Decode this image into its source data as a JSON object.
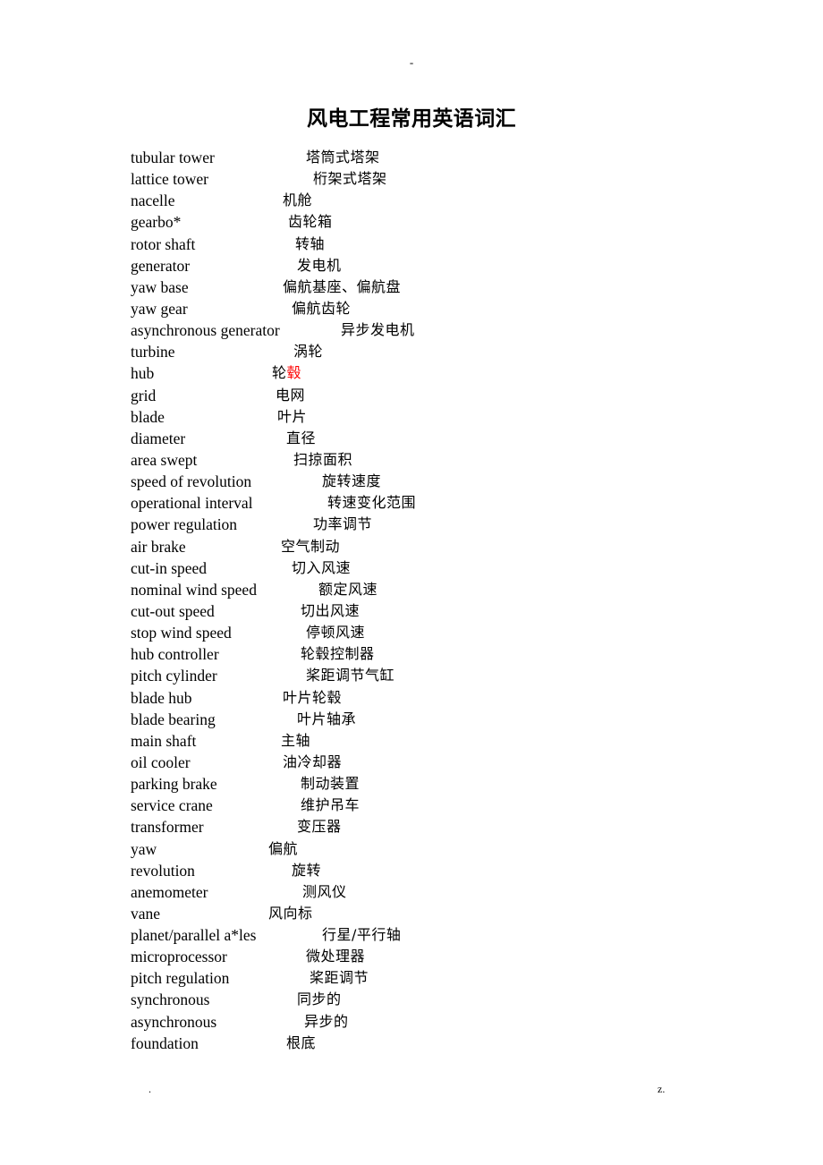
{
  "header": {
    "mark": "-"
  },
  "title": "风电工程常用英语词汇",
  "footer": {
    "left_mark": ".",
    "right_mark": "z."
  },
  "glossary": {
    "rows": [
      {
        "en": "tubular tower",
        "zh": "塔筒式塔架",
        "indent": 196
      },
      {
        "en": "lattice tower",
        "zh": "桁架式塔架",
        "indent": 204
      },
      {
        "en": "nacelle",
        "zh": "机舱",
        "indent": 170
      },
      {
        "en": "gearbo*",
        "zh": "齿轮箱",
        "indent": 176
      },
      {
        "en": "rotor shaft",
        "zh": "转轴",
        "indent": 184
      },
      {
        "en": "generator",
        "zh": "发电机",
        "indent": 186
      },
      {
        "en": "yaw base",
        "zh": "偏航基座、偏航盘",
        "indent": 170
      },
      {
        "en": "yaw gear",
        "zh": "偏航齿轮",
        "indent": 180
      },
      {
        "en": "asynchronous generator",
        "zh": "异步发电机",
        "indent": 235
      },
      {
        "en": "turbine",
        "zh": "涡轮",
        "indent": 182
      },
      {
        "en": "hub",
        "zh": "轮毂",
        "indent": 158,
        "highlight_from": 1
      },
      {
        "en": "grid",
        "zh": "电网",
        "indent": 162
      },
      {
        "en": "blade",
        "zh": "叶片",
        "indent": 164
      },
      {
        "en": "diameter",
        "zh": "直径",
        "indent": 174
      },
      {
        "en": "area swept",
        "zh": "扫掠面积",
        "indent": 182
      },
      {
        "en": "speed of revolution",
        "zh": "旋转速度",
        "indent": 214
      },
      {
        "en": "operational interval",
        "zh": "转速变化范围",
        "indent": 220
      },
      {
        "en": "power regulation",
        "zh": "功率调节",
        "indent": 204
      },
      {
        "en": "air brake",
        "zh": "空气制动",
        "indent": 168
      },
      {
        "en": "cut-in speed",
        "zh": "切入风速",
        "indent": 180
      },
      {
        "en": "nominal wind speed",
        "zh": "额定风速",
        "indent": 210
      },
      {
        "en": "cut-out speed",
        "zh": "切出风速",
        "indent": 190
      },
      {
        "en": "stop wind speed",
        "zh": "停顿风速",
        "indent": 196
      },
      {
        "en": "hub controller",
        "zh": "轮毂控制器",
        "indent": 190
      },
      {
        "en": "pitch cylinder",
        "zh": "桨距调节气缸",
        "indent": 196
      },
      {
        "en": "blade hub",
        "zh": "叶片轮毂",
        "indent": 170
      },
      {
        "en": "blade bearing",
        "zh": "叶片轴承",
        "indent": 186
      },
      {
        "en": "main shaft",
        "zh": "主轴",
        "indent": 168
      },
      {
        "en": "oil cooler",
        "zh": "油冷却器",
        "indent": 170
      },
      {
        "en": "parking brake",
        "zh": "制动装置",
        "indent": 190
      },
      {
        "en": "service crane",
        "zh": "维护吊车",
        "indent": 190
      },
      {
        "en": "transformer",
        "zh": "变压器",
        "indent": 186
      },
      {
        "en": "yaw",
        "zh": "偏航",
        "indent": 154
      },
      {
        "en": "revolution",
        "zh": "旋转",
        "indent": 180
      },
      {
        "en": "anemometer",
        "zh": "测风仪",
        "indent": 192
      },
      {
        "en": "vane",
        "zh": "风向标",
        "indent": 154
      },
      {
        "en": "planet/parallel a*les",
        "zh": "行星/平行轴",
        "indent": 214
      },
      {
        "en": "microprocessor",
        "zh": "微处理器",
        "indent": 196
      },
      {
        "en": "pitch regulation",
        "zh": "桨距调节",
        "indent": 200
      },
      {
        "en": "synchronous",
        "zh": "同步的",
        "indent": 186
      },
      {
        "en": "asynchronous",
        "zh": "异步的",
        "indent": 194
      },
      {
        "en": "foundation",
        "zh": "根底",
        "indent": 174
      }
    ]
  }
}
